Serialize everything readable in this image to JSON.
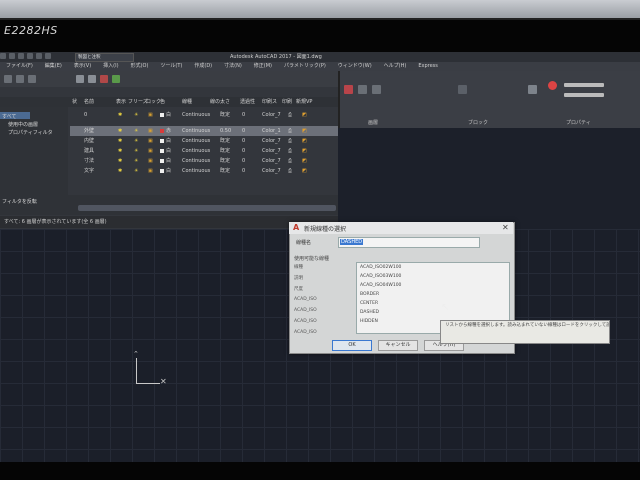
{
  "monitor": {
    "brand": "E2282HS"
  },
  "app": {
    "title": "Autodesk AutoCAD 2017 - 図面1.dwg",
    "workspace": "製図と注釈"
  },
  "menubar": [
    "ファイル(F)",
    "編集(E)",
    "表示(V)",
    "挿入(I)",
    "形式(O)",
    "ツール(T)",
    "作成(D)",
    "寸法(N)",
    "修正(M)",
    "パラメトリック(P)",
    "ウィンドウ(W)",
    "ヘルプ(H)",
    "Express"
  ],
  "ribbon": {
    "groups": [
      "画層",
      "ブロック",
      "プロパティ"
    ]
  },
  "layer_panel": {
    "filter_tree": [
      {
        "label": "すべて"
      },
      {
        "label": "使用中の画層"
      },
      {
        "label": "プロパティフィルタ"
      }
    ],
    "filter_footer": "フィルタを反転",
    "columns": [
      "状",
      "名前",
      "表示",
      "フリーズ",
      "ロック",
      "色",
      "線種",
      "線の太さ",
      "透過性",
      "印刷ス",
      "印刷",
      "新規VP"
    ],
    "rows": [
      {
        "name": "0",
        "color": "白",
        "linetype": "Continuous",
        "lineweight": "既定",
        "transparency": "0",
        "plotstyle": "Color_7"
      },
      {
        "name": "外壁",
        "color": "赤",
        "linetype": "Continuous",
        "lineweight": "0.50",
        "transparency": "0",
        "plotstyle": "Color_1",
        "selected": true
      },
      {
        "name": "内壁",
        "color": "白",
        "linetype": "Continuous",
        "lineweight": "既定",
        "transparency": "0",
        "plotstyle": "Color_7"
      },
      {
        "name": "建具",
        "color": "白",
        "linetype": "Continuous",
        "lineweight": "既定",
        "transparency": "0",
        "plotstyle": "Color_7"
      },
      {
        "name": "寸法",
        "color": "白",
        "linetype": "Continuous",
        "lineweight": "既定",
        "transparency": "0",
        "plotstyle": "Color_7"
      },
      {
        "name": "文字",
        "color": "白",
        "linetype": "Continuous",
        "lineweight": "既定",
        "transparency": "0",
        "plotstyle": "Color_7"
      }
    ],
    "status": "すべて: 6 画層が表示されています(全 6 画層)"
  },
  "dialog": {
    "title": "新規線種の選択",
    "name_label": "線種名",
    "name_value": "DASHED",
    "section": "使用可能な線種",
    "list": [
      "ACAD_ISO02W100",
      "ACAD_ISO03W100",
      "ACAD_ISO04W100",
      "BORDER",
      "CENTER",
      "DASHED",
      "HIDDEN"
    ],
    "labels": [
      "線種",
      "説明",
      "尺度",
      "ACAD_ISO",
      "ACAD_ISO",
      "ACAD_ISO",
      "ACAD_ISO"
    ],
    "ok": "OK",
    "cancel": "キャンセル",
    "help": "ヘルプ(H)"
  },
  "tooltip": "リストから線種を選択します。読み込まれていない線種はロードをクリックして読み込んでください。",
  "colors": {
    "accent": "#3a78d0",
    "canvas": "#1b1f29",
    "panel": "#33363c"
  }
}
